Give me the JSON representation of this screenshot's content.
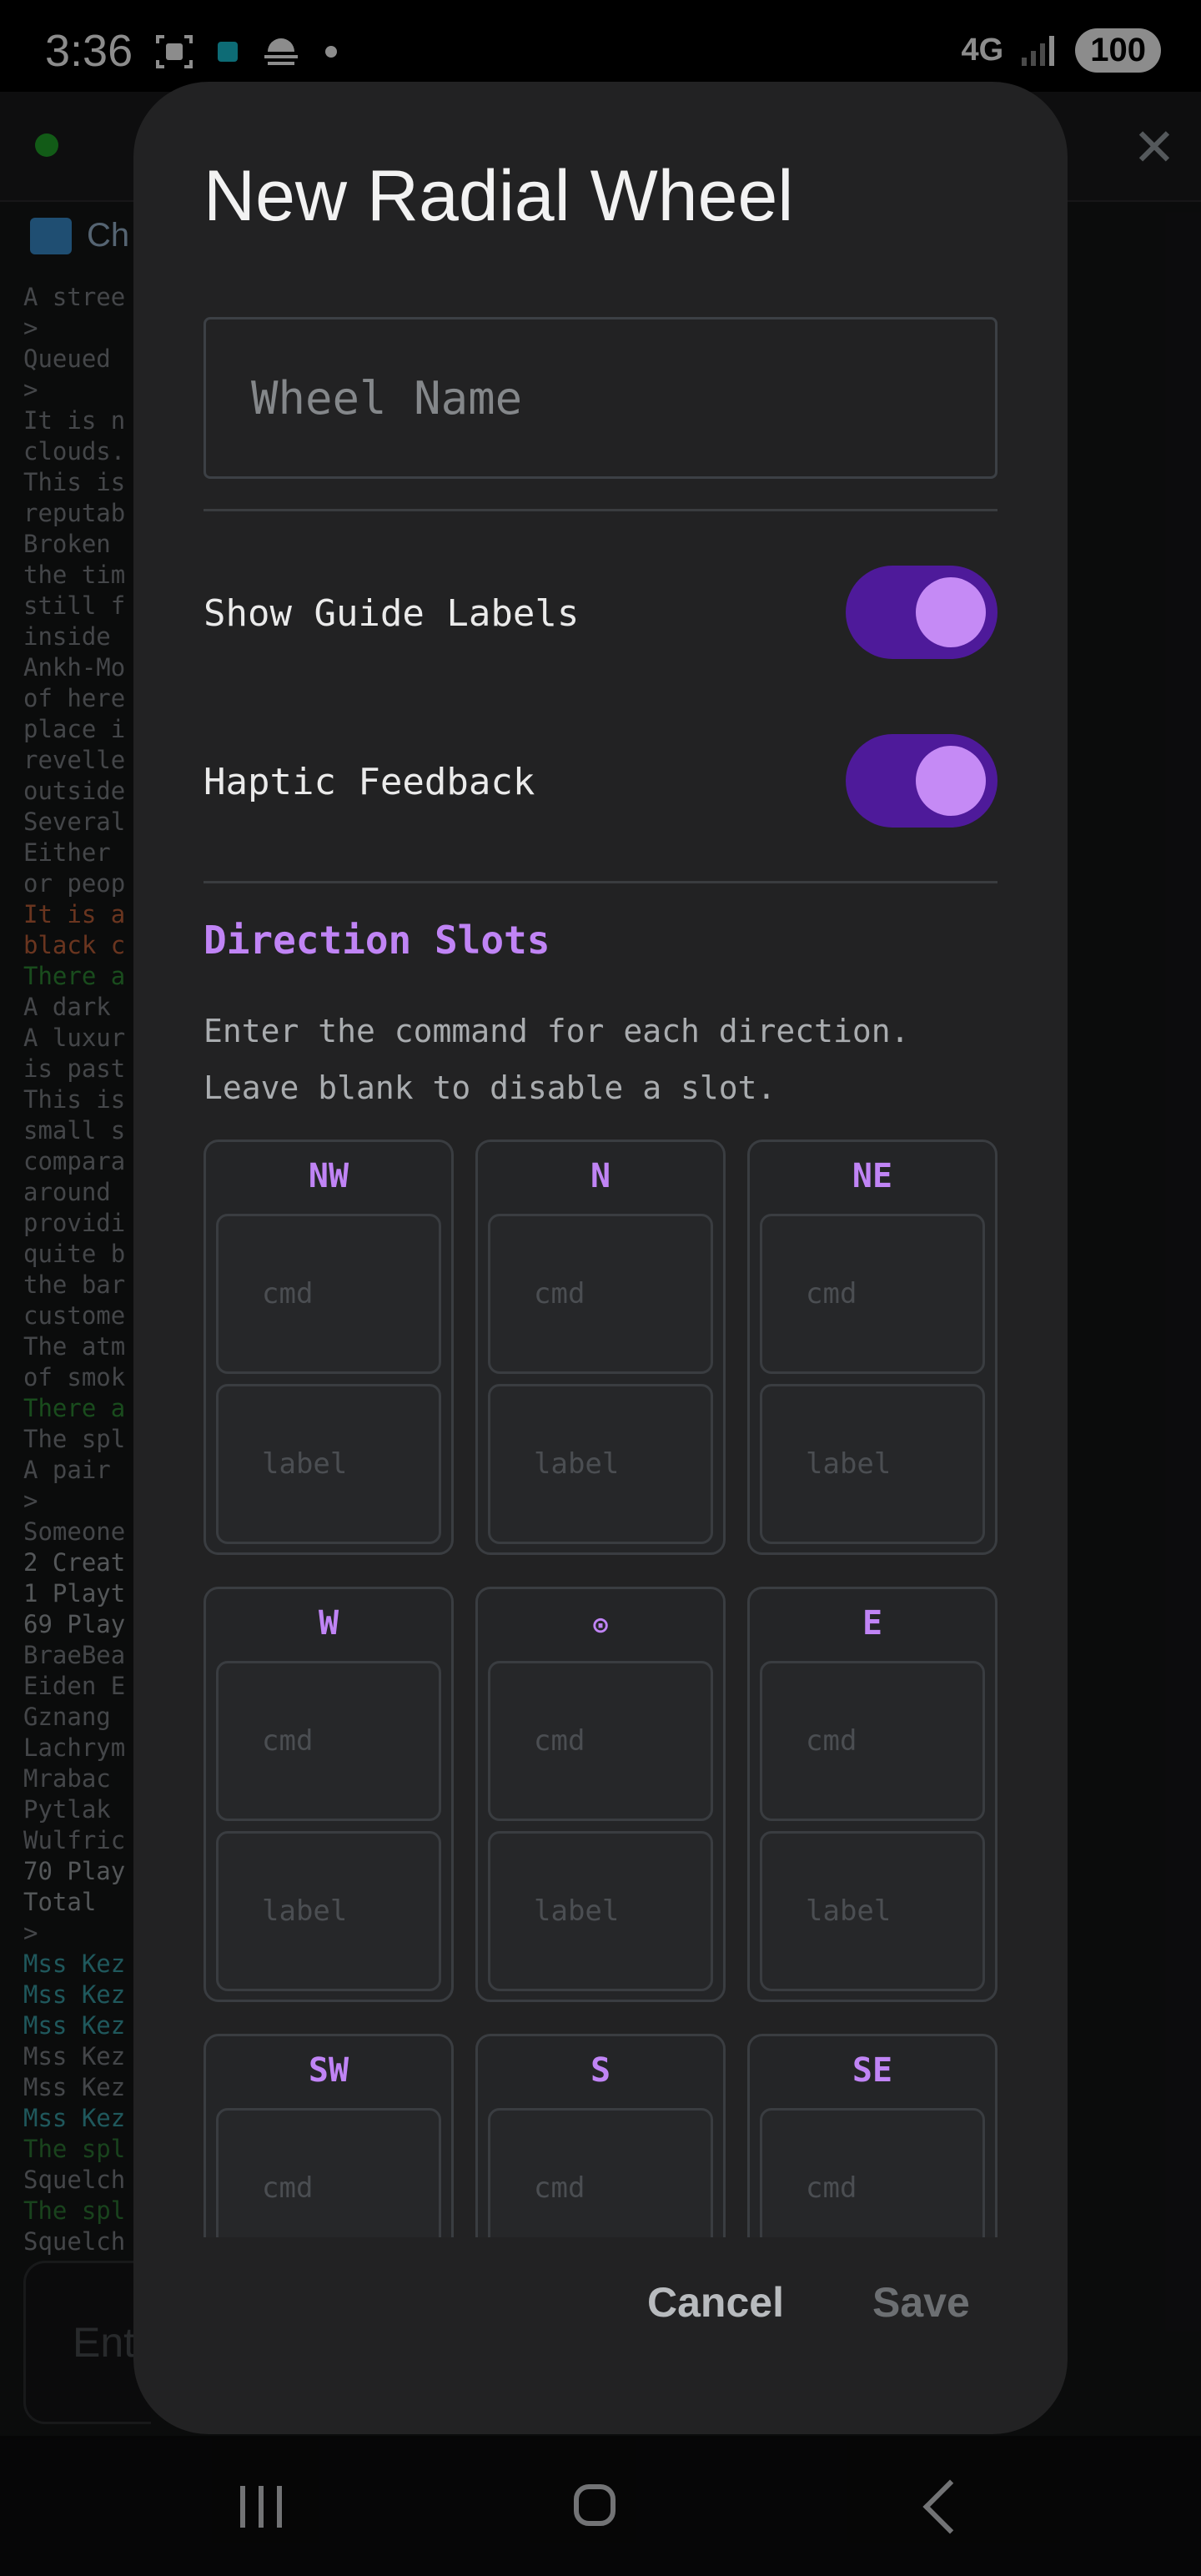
{
  "status_bar": {
    "time": "3:36",
    "network": "4G",
    "battery": "100"
  },
  "background": {
    "tab_label": "Ch",
    "lines": [
      {
        "text": "A stree",
        "color": "#7c8085"
      },
      {
        "text": ">",
        "color": "#7c8085"
      },
      {
        "text": "Queued",
        "color": "#7c8085"
      },
      {
        "text": ">",
        "color": "#7c8085"
      },
      {
        "text": "It is n",
        "color": "#7c8085"
      },
      {
        "text": "clouds.",
        "color": "#7c8085"
      },
      {
        "text": "This is",
        "color": "#7c8085"
      },
      {
        "text": "reputab",
        "color": "#7c8085"
      },
      {
        "text": "Broken",
        "color": "#7c8085"
      },
      {
        "text": "the tim",
        "color": "#7c8085"
      },
      {
        "text": "still f",
        "color": "#7c8085"
      },
      {
        "text": "inside",
        "color": "#7c8085"
      },
      {
        "text": "Ankh-Mo",
        "color": "#7c8085"
      },
      {
        "text": "of here",
        "color": "#7c8085"
      },
      {
        "text": "place i",
        "color": "#7c8085"
      },
      {
        "text": "revelle",
        "color": "#7c8085"
      },
      {
        "text": "outside",
        "color": "#7c8085"
      },
      {
        "text": "Several",
        "color": "#7c8085"
      },
      {
        "text": "Either",
        "color": "#7c8085"
      },
      {
        "text": "or peop",
        "color": "#7c8085"
      },
      {
        "text": "It is a",
        "color": "#c2613a"
      },
      {
        "text": "black c",
        "color": "#c2613a"
      },
      {
        "text": "There a",
        "color": "#2f8a35"
      },
      {
        "text": "A dark",
        "color": "#7c8085"
      },
      {
        "text": "A luxur",
        "color": "#7c8085"
      },
      {
        "text": "is past",
        "color": "#7c8085"
      },
      {
        "text": "This is",
        "color": "#7c8085"
      },
      {
        "text": "small s",
        "color": "#7c8085"
      },
      {
        "text": "compara",
        "color": "#7c8085"
      },
      {
        "text": "around",
        "color": "#7c8085"
      },
      {
        "text": "providi",
        "color": "#7c8085"
      },
      {
        "text": "quite b",
        "color": "#7c8085"
      },
      {
        "text": "the bar",
        "color": "#7c8085"
      },
      {
        "text": "custome",
        "color": "#7c8085"
      },
      {
        "text": "The atm",
        "color": "#7c8085"
      },
      {
        "text": "of smok",
        "color": "#7c8085"
      },
      {
        "text": "There a",
        "color": "#2f8a35"
      },
      {
        "text": "The spl",
        "color": "#7c8085"
      },
      {
        "text": "A pair",
        "color": "#7c8085"
      },
      {
        "text": ">",
        "color": "#7c8085"
      },
      {
        "text": "Someone",
        "color": "#7c8085"
      },
      {
        "text": "2 Creat",
        "color": "#9a9ea3"
      },
      {
        "text": "1 Playt",
        "color": "#9a9ea3"
      },
      {
        "text": "69 Play",
        "color": "#9a9ea3"
      },
      {
        "text": "BraeBea",
        "color": "#7c8085"
      },
      {
        "text": "Eiden E",
        "color": "#7c8085"
      },
      {
        "text": "Gznang",
        "color": "#7c8085"
      },
      {
        "text": "Lachrym",
        "color": "#7c8085"
      },
      {
        "text": "Mrabac",
        "color": "#7c8085"
      },
      {
        "text": "Pytlak",
        "color": "#7c8085"
      },
      {
        "text": "Wulfric",
        "color": "#7c8085"
      },
      {
        "text": "70 Play",
        "color": "#9a9ea3"
      },
      {
        "text": "Total",
        "color": "#9a9ea3"
      },
      {
        "text": ">",
        "color": "#7c8085"
      },
      {
        "text": "Mss Kez",
        "color": "#3aa0a8"
      },
      {
        "text": "Mss Kez",
        "color": "#3aa0a8"
      },
      {
        "text": "Mss Kez",
        "color": "#3aa0a8"
      },
      {
        "text": "Mss Kez",
        "color": "#7c8085"
      },
      {
        "text": "Mss Kez",
        "color": "#7c8085"
      },
      {
        "text": "Mss Kez",
        "color": "#3aa0a8"
      },
      {
        "text": "The spl",
        "color": "#2f7a35"
      },
      {
        "text": "Squelch",
        "color": "#7c8085"
      },
      {
        "text": "The spl",
        "color": "#2f7a35"
      },
      {
        "text": "Squelch",
        "color": "#7c8085"
      }
    ],
    "input_placeholder": "Ent"
  },
  "dialog": {
    "title": "New Radial Wheel",
    "name_placeholder": "Wheel Name",
    "name_value": "",
    "toggles": [
      {
        "label": "Show Guide Labels",
        "on": true
      },
      {
        "label": "Haptic Feedback",
        "on": true
      }
    ],
    "section_title": "Direction Slots",
    "section_desc_line1": "Enter the command for each direction.",
    "section_desc_line2": "Leave blank to disable a slot.",
    "slots": [
      {
        "id": "nw",
        "label": "NW"
      },
      {
        "id": "n",
        "label": "N"
      },
      {
        "id": "ne",
        "label": "NE"
      },
      {
        "id": "w",
        "label": "W"
      },
      {
        "id": "center",
        "label": "⊙"
      },
      {
        "id": "e",
        "label": "E"
      },
      {
        "id": "sw",
        "label": "SW"
      },
      {
        "id": "s",
        "label": "S"
      },
      {
        "id": "se",
        "label": "SE"
      }
    ],
    "cmd_placeholder": "cmd",
    "label_placeholder": "label",
    "cancel_label": "Cancel",
    "save_label": "Save"
  },
  "colors": {
    "accent": "#c084f5",
    "switch_track": "#4e1a9a",
    "switch_knob": "#c58af5",
    "dialog_bg": "#222223"
  }
}
